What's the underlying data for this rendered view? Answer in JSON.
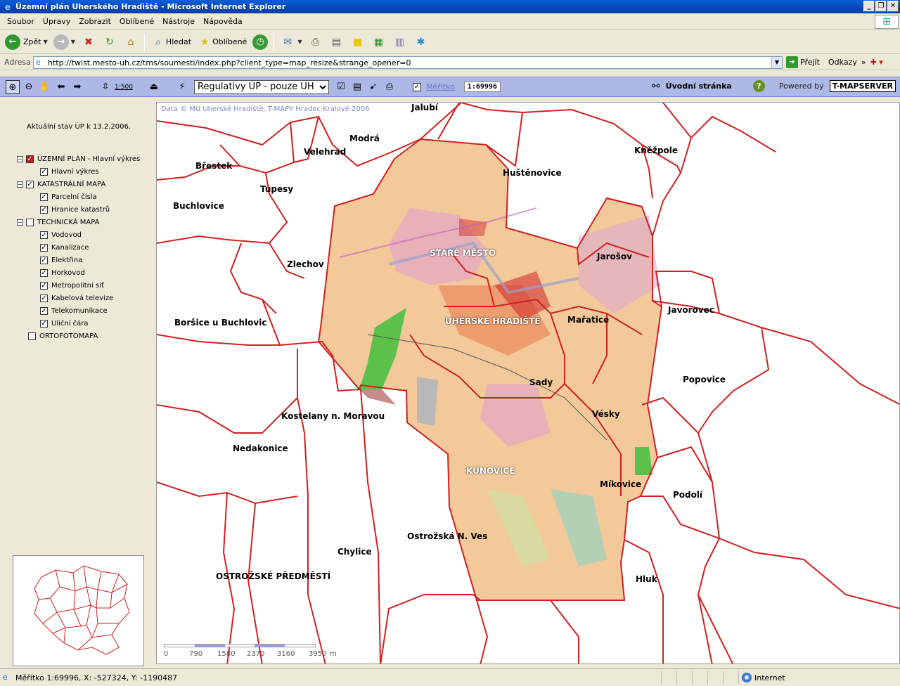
{
  "window": {
    "title": "Územní plán Uherského Hradiště - Microsoft Internet Explorer"
  },
  "menu": [
    "Soubor",
    "Úpravy",
    "Zobrazit",
    "Oblíbené",
    "Nástroje",
    "Nápověda"
  ],
  "toolbar": {
    "back_label": "Zpět",
    "search_label": "Hledat",
    "favorites_label": "Oblíbené"
  },
  "address": {
    "label": "Adresa",
    "url": "http://twist.mesto-uh.cz/tms/soumesti/index.php?client_type=map_resize&strange_opener=0",
    "go_label": "Přejít",
    "links_label": "Odkazy"
  },
  "app": {
    "scale_button": "1:500",
    "layer_select": "Regulativy ÚP - pouze UH",
    "scale_link": "Měřítko",
    "scale_value": "1:69996",
    "home_label": "Úvodní stránka",
    "powered_by": "Powered by",
    "server_logo": "T-MAPSERVER"
  },
  "panel": {
    "state_text": "Aktuální stav ÚP k 13.2.2006.",
    "tree": [
      {
        "id": "uzemni-plan",
        "label": "ÚZEMNÍ PLÁN - Hlavní výkres",
        "level": 1,
        "toggle": "−",
        "checked": true,
        "red": true
      },
      {
        "id": "hlavni-vykres",
        "label": "Hlavní výkres",
        "level": 2,
        "checked": true
      },
      {
        "id": "katastralni-mapa",
        "label": "KATASTRÁLNÍ MAPA",
        "level": 1,
        "toggle": "−",
        "checked": true
      },
      {
        "id": "parcelni-cisla",
        "label": "Parcelní čísla",
        "level": 2,
        "checked": true
      },
      {
        "id": "hranice-katastru",
        "label": "Hranice katastrů",
        "level": 2,
        "checked": true
      },
      {
        "id": "technicka-mapa",
        "label": "TECHNICKÁ MAPA",
        "level": 1,
        "toggle": "−",
        "checked": false
      },
      {
        "id": "vodovod",
        "label": "Vodovod",
        "level": 2,
        "checked": true
      },
      {
        "id": "kanalizace",
        "label": "Kanalizace",
        "level": 2,
        "checked": true
      },
      {
        "id": "elektrina",
        "label": "Elektřina",
        "level": 2,
        "checked": true
      },
      {
        "id": "horkovod",
        "label": "Horkovod",
        "level": 2,
        "checked": true
      },
      {
        "id": "metropolitni-sit",
        "label": "Metropolitní síť",
        "level": 2,
        "checked": true
      },
      {
        "id": "kabelova-televize",
        "label": "Kabelová televize",
        "level": 2,
        "checked": true
      },
      {
        "id": "telekomunikace",
        "label": "Telekomunikace",
        "level": 2,
        "checked": true
      },
      {
        "id": "ulicni-cara",
        "label": "Uliční čára",
        "level": 2,
        "checked": true
      },
      {
        "id": "ortofotomapa",
        "label": "ORTOFOTOMAPA",
        "level": 1,
        "checked": false,
        "notoggle": true
      }
    ]
  },
  "map": {
    "copyright": "Data © MU Uherské Hradiště, T-MAPY Hradec Králové 2006",
    "places": [
      "Jalubí",
      "Modrá",
      "Velehrad",
      "Kněžpole",
      "Huštěnovice",
      "Břestek",
      "Tupesy",
      "Buchlovice",
      "STARÉ MĚSTO",
      "Jarošov",
      "Zlechov",
      "Javorovec",
      "UHERSKÉ HRADIŠTĚ",
      "Mařatice",
      "Boršice u Buchlovic",
      "Sady",
      "Popovice",
      "Kostelany n. Moravou",
      "Vésky",
      "Nedakonice",
      "KUNOVICE",
      "Míkovice",
      "Podolí",
      "Ostrožská N. Ves",
      "Chylice",
      "OSTROŽSKÉ PŘEDMĚSTÍ",
      "Hluk"
    ],
    "scalebar": [
      "0",
      "790",
      "1580",
      "2370",
      "3160",
      "3950",
      "m"
    ]
  },
  "status": {
    "text": "Měřítko 1:69996, X: -527324, Y: -1190487",
    "zone": "Internet"
  }
}
